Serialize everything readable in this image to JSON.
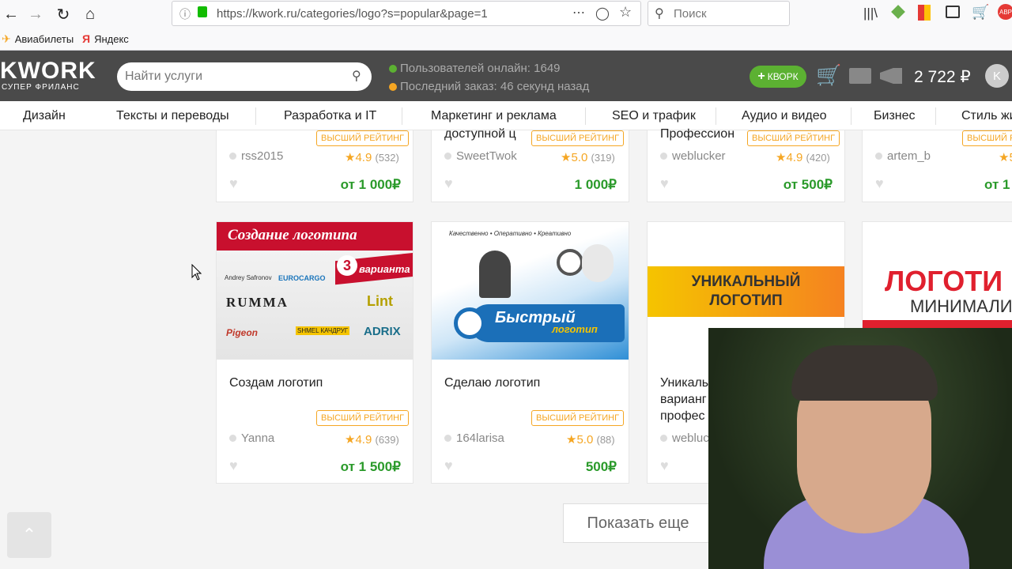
{
  "browser": {
    "url": "https://kwork.ru/categories/logo?s=popular&page=1",
    "search_placeholder": "Поиск",
    "bookmarks": [
      "Авиабилеты",
      "Яндекс"
    ]
  },
  "header": {
    "logo": "KWORK",
    "logo_sub": "СУПЕР ФРИЛАНС",
    "search_placeholder": "Найти услуги",
    "users_online": "Пользователей онлайн: 1649",
    "last_order": "Последний заказ: 46 секунд назад",
    "kwork_button": "КВОРК",
    "balance": "2 722 ₽",
    "avatar_letter": "K"
  },
  "categories": [
    "Дизайн",
    "Тексты и переводы",
    "Разработка и IT",
    "Маркетинг и реклама",
    "SEO и трафик",
    "Аудио и видео",
    "Бизнес",
    "Стиль жи"
  ],
  "top_cards": [
    {
      "title": "",
      "badge": "ВЫСШИЙ РЕЙТИНГ",
      "seller": "rss2015",
      "rating": "4.9",
      "reviews": "(532)",
      "price": "от 1 000₽"
    },
    {
      "title": "доступной ц",
      "badge": "ВЫСШИЙ РЕЙТИНГ",
      "seller": "SweetTwok",
      "rating": "5.0",
      "reviews": "(319)",
      "price": "1 000₽"
    },
    {
      "title": "Профессион",
      "badge": "ВЫСШИЙ РЕЙТИНГ",
      "seller": "weblucker",
      "rating": "4.9",
      "reviews": "(420)",
      "price": "от 500₽"
    },
    {
      "title": "",
      "badge": "ВЫСШИЙ РЕЙТИНГ",
      "seller": "artem_b",
      "rating": "5",
      "reviews": "",
      "price": "от 1"
    }
  ],
  "cards": [
    {
      "title": "Создам логотип",
      "badge": "ВЫСШИЙ РЕЙТИНГ",
      "seller": "Yanna",
      "rating": "4.9",
      "reviews": "(639)",
      "price": "от 1 500₽",
      "img_title": "Создание логотипа",
      "img_badge_num": "3",
      "img_badge_text": "варианта",
      "img_logos": [
        "Andrey Safronov",
        "EUROCARGO",
        "RUMMA",
        "Lint",
        "Pigeon",
        "SHMEL КАЧДРУГ",
        "ADRIX"
      ]
    },
    {
      "title": "Сделаю логотип",
      "badge": "ВЫСШИЙ РЕЙТИНГ",
      "seller": "164larisa",
      "rating": "5.0",
      "reviews": "(88)",
      "price": "500₽",
      "img_top": "Качественно • Оперативно • Креативно",
      "img_main": "Быстрый",
      "img_sub": "логотип"
    },
    {
      "title": "Уникаль варианг профес",
      "badge": "",
      "seller": "webluc",
      "rating": "",
      "reviews": "",
      "price": "",
      "img_text1": "УНИКАЛЬНЫЙ",
      "img_text2": "ЛОГОТИП"
    },
    {
      "title": "",
      "badge": "",
      "seller": "",
      "rating": "",
      "reviews": "",
      "price": "",
      "img_text1": "ЛОГОТИ",
      "img_text2": "МИНИМАЛИ"
    }
  ],
  "show_more": "Показать еще",
  "to_top": "⌃"
}
